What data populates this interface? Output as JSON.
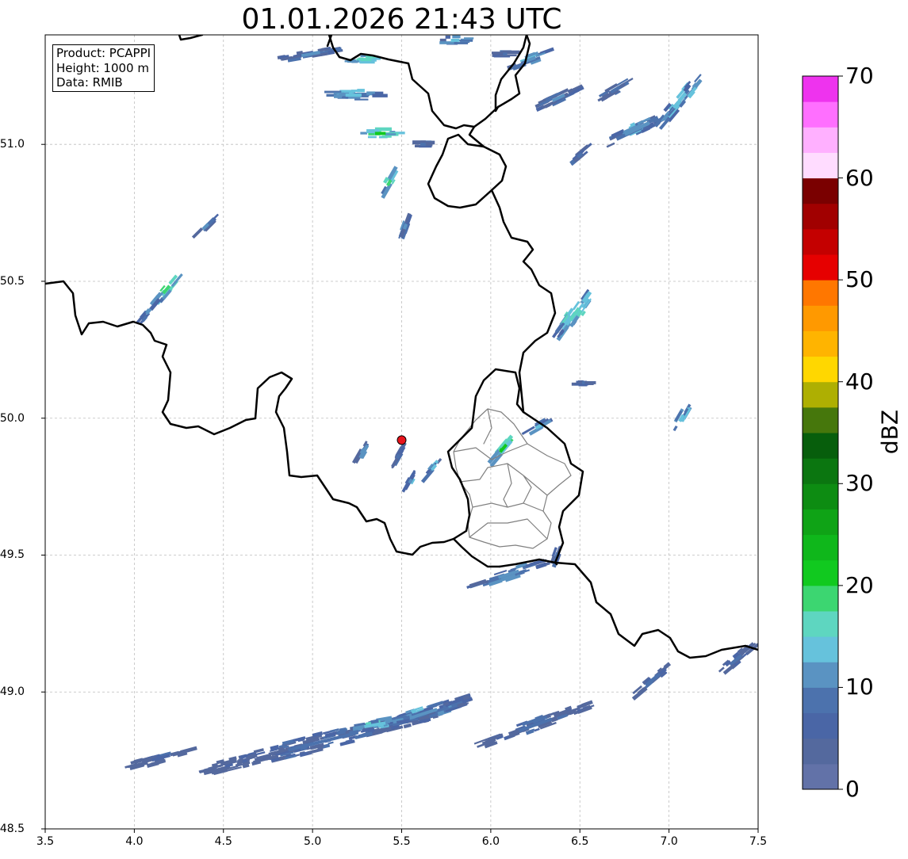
{
  "title": "01.01.2026 21:43 UTC",
  "info_box": {
    "line1": "Product: PCAPPI",
    "line2": "Height: 1000 m",
    "line3": "Data: RMIB"
  },
  "axes": {
    "x_ticks": [
      "3.5",
      "4.0",
      "4.5",
      "5.0",
      "5.5",
      "6.0",
      "6.5",
      "7.0",
      "7.5"
    ],
    "y_ticks": [
      "48.5",
      "49.0",
      "49.5",
      "50.0",
      "50.5",
      "51.0"
    ],
    "lon_range": [
      3.5,
      7.5
    ],
    "lat_range": [
      48.5,
      51.4
    ],
    "grid": true
  },
  "radar_site": {
    "lon": 5.5,
    "lat": 49.92,
    "color": "#e8141c"
  },
  "colorbar": {
    "label": "dBZ",
    "range": [
      0,
      70
    ],
    "ticks": [
      "0",
      "10",
      "20",
      "30",
      "40",
      "50",
      "60",
      "70"
    ],
    "colors": [
      "#6272a8",
      "#54699e",
      "#4a66a6",
      "#4c72ad",
      "#5a93c2",
      "#66c2dc",
      "#5ed6c0",
      "#3cd671",
      "#11c91f",
      "#0fb71b",
      "#0fa316",
      "#0d8c12",
      "#0b7610",
      "#075e0c",
      "#46770c",
      "#aeaf02",
      "#ffd700",
      "#ffb400",
      "#ff9900",
      "#ff7700",
      "#e60000",
      "#c40000",
      "#a10000",
      "#7a0000",
      "#ffdcff",
      "#ffb0ff",
      "#ff6fff",
      "#ee33ee"
    ]
  },
  "echoes": [
    {
      "lon": 5.06,
      "lat": 48.82,
      "len": 1.35,
      "w": 0.1,
      "rot": -14,
      "dbz": 8
    },
    {
      "lon": 5.62,
      "lat": 48.92,
      "len": 0.55,
      "w": 0.08,
      "rot": -18,
      "dbz": 12
    },
    {
      "lon": 5.35,
      "lat": 48.88,
      "len": 0.4,
      "w": 0.06,
      "rot": -10,
      "dbz": 14
    },
    {
      "lon": 6.25,
      "lat": 48.88,
      "len": 0.65,
      "w": 0.07,
      "rot": -20,
      "dbz": 8
    },
    {
      "lon": 4.15,
      "lat": 48.76,
      "len": 0.35,
      "w": 0.06,
      "rot": -15,
      "dbz": 7
    },
    {
      "lon": 6.1,
      "lat": 49.43,
      "len": 0.4,
      "w": 0.06,
      "rot": -18,
      "dbz": 12
    },
    {
      "lon": 6.92,
      "lat": 49.05,
      "len": 0.25,
      "w": 0.05,
      "rot": -40,
      "dbz": 8
    },
    {
      "lon": 7.38,
      "lat": 49.12,
      "len": 0.22,
      "w": 0.07,
      "rot": -40,
      "dbz": 8
    },
    {
      "lon": 4.18,
      "lat": 50.47,
      "len": 0.18,
      "w": 0.06,
      "rot": -50,
      "dbz": 18
    },
    {
      "lon": 4.08,
      "lat": 50.39,
      "len": 0.12,
      "w": 0.04,
      "rot": -50,
      "dbz": 12
    },
    {
      "lon": 4.4,
      "lat": 50.7,
      "len": 0.14,
      "w": 0.04,
      "rot": -45,
      "dbz": 10
    },
    {
      "lon": 5.38,
      "lat": 51.04,
      "len": 0.2,
      "w": 0.06,
      "rot": 0,
      "dbz": 20
    },
    {
      "lon": 5.43,
      "lat": 50.86,
      "len": 0.12,
      "w": 0.05,
      "rot": -60,
      "dbz": 18
    },
    {
      "lon": 5.52,
      "lat": 50.7,
      "len": 0.1,
      "w": 0.04,
      "rot": -70,
      "dbz": 10
    },
    {
      "lon": 5.23,
      "lat": 51.18,
      "len": 0.3,
      "w": 0.06,
      "rot": 0,
      "dbz": 14
    },
    {
      "lon": 5.62,
      "lat": 51.0,
      "len": 0.1,
      "w": 0.03,
      "rot": 0,
      "dbz": 9
    },
    {
      "lon": 4.99,
      "lat": 51.33,
      "len": 0.35,
      "w": 0.05,
      "rot": -10,
      "dbz": 10
    },
    {
      "lon": 5.3,
      "lat": 51.31,
      "len": 0.2,
      "w": 0.05,
      "rot": 0,
      "dbz": 16
    },
    {
      "lon": 5.8,
      "lat": 51.38,
      "len": 0.16,
      "w": 0.05,
      "rot": 0,
      "dbz": 14
    },
    {
      "lon": 6.08,
      "lat": 51.33,
      "len": 0.08,
      "w": 0.03,
      "rot": 0,
      "dbz": 8
    },
    {
      "lon": 6.22,
      "lat": 51.31,
      "len": 0.22,
      "w": 0.06,
      "rot": -20,
      "dbz": 12
    },
    {
      "lon": 6.38,
      "lat": 51.17,
      "len": 0.25,
      "w": 0.06,
      "rot": -25,
      "dbz": 10
    },
    {
      "lon": 6.7,
      "lat": 51.2,
      "len": 0.2,
      "w": 0.05,
      "rot": -30,
      "dbz": 9
    },
    {
      "lon": 6.8,
      "lat": 51.05,
      "len": 0.35,
      "w": 0.07,
      "rot": -25,
      "dbz": 12
    },
    {
      "lon": 7.06,
      "lat": 51.16,
      "len": 0.35,
      "w": 0.08,
      "rot": -50,
      "dbz": 14
    },
    {
      "lon": 6.5,
      "lat": 50.96,
      "len": 0.1,
      "w": 0.04,
      "rot": -40,
      "dbz": 9
    },
    {
      "lon": 6.47,
      "lat": 50.38,
      "len": 0.28,
      "w": 0.09,
      "rot": -55,
      "dbz": 16
    },
    {
      "lon": 6.52,
      "lat": 50.13,
      "len": 0.05,
      "w": 0.03,
      "rot": 0,
      "dbz": 8
    },
    {
      "lon": 6.27,
      "lat": 49.97,
      "len": 0.14,
      "w": 0.04,
      "rot": -30,
      "dbz": 14
    },
    {
      "lon": 6.07,
      "lat": 49.89,
      "len": 0.18,
      "w": 0.05,
      "rot": -50,
      "dbz": 20
    },
    {
      "lon": 7.07,
      "lat": 50.0,
      "len": 0.14,
      "w": 0.05,
      "rot": -60,
      "dbz": 14
    },
    {
      "lon": 5.28,
      "lat": 49.88,
      "len": 0.1,
      "w": 0.03,
      "rot": -60,
      "dbz": 12
    },
    {
      "lon": 5.48,
      "lat": 49.86,
      "len": 0.08,
      "w": 0.02,
      "rot": -60,
      "dbz": 9
    },
    {
      "lon": 5.68,
      "lat": 49.82,
      "len": 0.12,
      "w": 0.03,
      "rot": -50,
      "dbz": 14
    },
    {
      "lon": 5.55,
      "lat": 49.77,
      "len": 0.08,
      "w": 0.03,
      "rot": -60,
      "dbz": 12
    },
    {
      "lon": 6.37,
      "lat": 49.5,
      "len": 0.1,
      "w": 0.04,
      "rot": -70,
      "dbz": 9
    }
  ]
}
